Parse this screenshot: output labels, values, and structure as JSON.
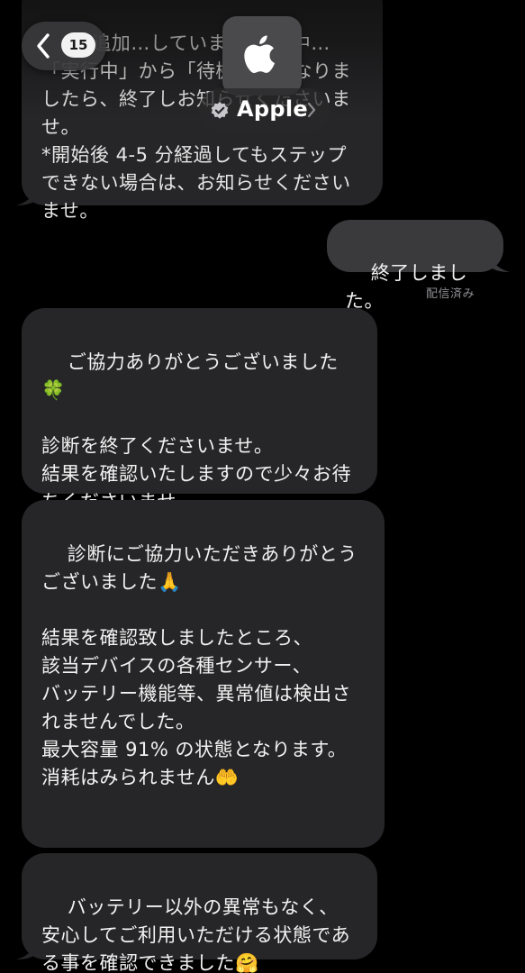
{
  "header": {
    "unread_count": "15",
    "contact_name": "Apple"
  },
  "messages": [
    {
      "direction": "incoming",
      "text": "■ 追加…していま… 進行中…\n「実行中」から「待機中」になりましたら、終了しお知らせくださいませ。\n*開始後 4-5 分経過してもステップできない場合は、お知らせくださいませ。"
    },
    {
      "direction": "outgoing",
      "text": "終了しました。",
      "status": "配信済み"
    },
    {
      "direction": "incoming",
      "text": "ご協力ありがとうございました🍀\n\n診断を終了くださいませ。\n結果を確認いたしますので少々お待ちくださいませ。"
    },
    {
      "direction": "incoming",
      "text": "診断にご協力いただきありがとうございました🙏\n\n結果を確認致しましたところ、\n該当デバイスの各種センサー、\nバッテリー機能等、異常値は検出されませんでした。\n最大容量 91% の状態となります。\n消耗はみられません🤲"
    },
    {
      "direction": "incoming",
      "text": "バッテリー以外の異常もなく、\n安心してご利用いただける状態である事を確認できました🤗"
    }
  ]
}
